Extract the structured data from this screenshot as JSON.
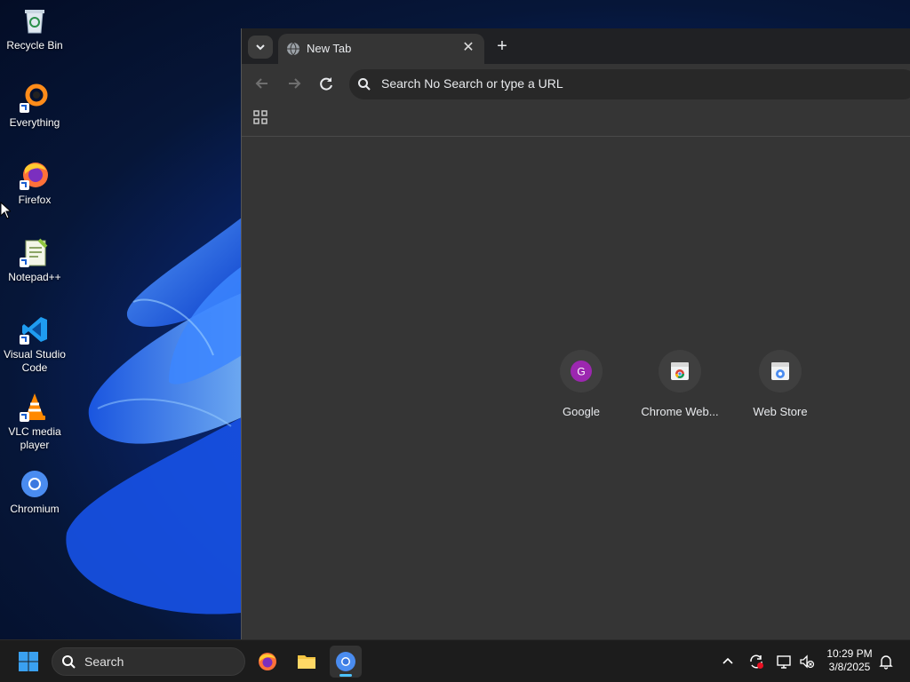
{
  "desktop": {
    "icons": [
      {
        "label": "Recycle Bin"
      },
      {
        "label": "Everything"
      },
      {
        "label": "Firefox"
      },
      {
        "label": "Notepad++"
      },
      {
        "label": "Visual Studio Code"
      },
      {
        "label": "VLC media player"
      },
      {
        "label": "Chromium"
      }
    ]
  },
  "browser": {
    "tab": {
      "title": "New Tab",
      "icon": "globe-icon"
    },
    "omnibox": {
      "text": "Search No Search or type a URL"
    },
    "shortcuts": [
      {
        "label": "Google",
        "letter": "G",
        "color": "#9c27b0"
      },
      {
        "label": "Chrome Web...",
        "icon": "web-store-icon"
      },
      {
        "label": "Web Store",
        "icon": "web-store-icon"
      }
    ]
  },
  "taskbar": {
    "search_label": "Search",
    "clock": {
      "time": "10:29 PM",
      "date": "3/8/2025"
    },
    "accent": "#4cc2ff"
  }
}
